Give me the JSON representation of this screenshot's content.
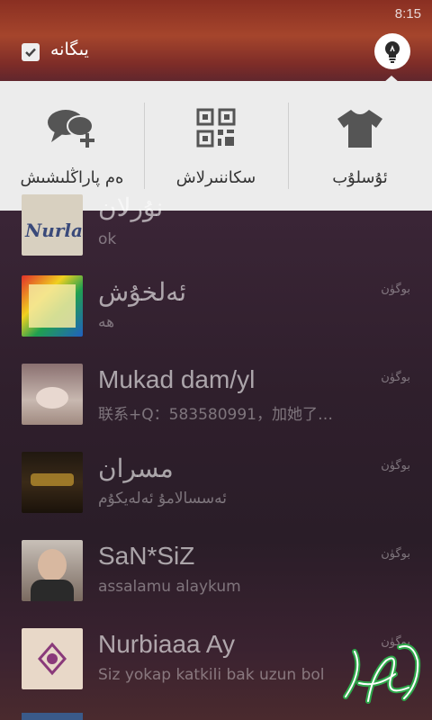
{
  "status": {
    "time": "8:15"
  },
  "topbar": {
    "stranger_label": "يىگانە",
    "stranger_checked": true,
    "bulb_icon": "lightbulb-icon"
  },
  "menu": {
    "items": [
      {
        "label": "ئۇسلۇب",
        "icon": "tshirt-icon"
      },
      {
        "label": "سكاننىرلاش",
        "icon": "qr-code-icon"
      },
      {
        "label": "ەم پاراڭلىشىش",
        "icon": "group-chat-add-icon"
      }
    ]
  },
  "chats": [
    {
      "name": "نۇرلان",
      "message": "ok",
      "time": "",
      "avatar_text": "Nurlan"
    },
    {
      "name": "ئەلخۇش",
      "message": "ھە",
      "time": "بوگۈن",
      "avatar_text": ""
    },
    {
      "name": "Mukad dam/yl",
      "message": "联系+Q：583580991，加她了…",
      "time": "بوگۈن",
      "avatar_text": ""
    },
    {
      "name": "مسران",
      "message": "ئەسسالامۇ ئەلەيكۇم",
      "time": "بوگۈن",
      "avatar_text": ""
    },
    {
      "name": "SaN*SiZ",
      "message": "assalamu alaykum",
      "time": "بوگۈن",
      "avatar_text": ""
    },
    {
      "name": "Nurbiaaa Ay",
      "message": "Siz yokap katkili bak uzun bol",
      "time": "بوگۈن",
      "avatar_text": ""
    }
  ],
  "watermark": {
    "text": "تالپۇرى"
  }
}
